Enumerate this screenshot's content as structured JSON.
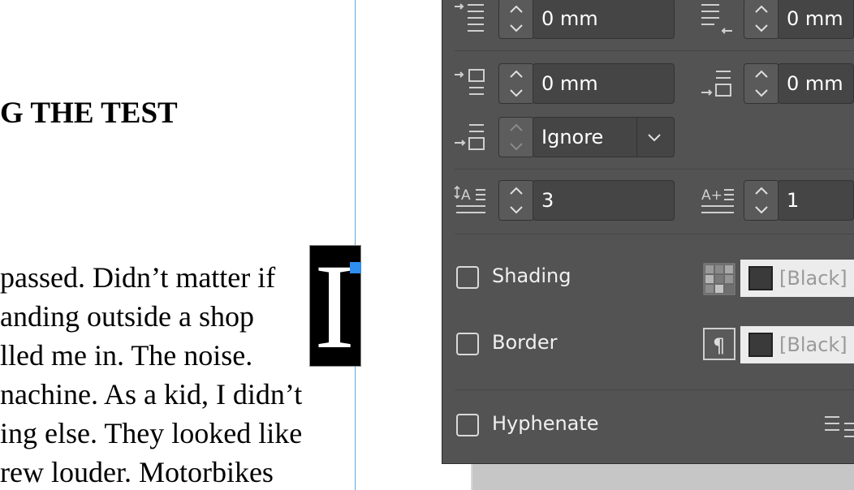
{
  "document": {
    "heading": "G THE TEST",
    "lines": [
      "passed. Didn’t matter if",
      "anding outside a shop",
      "lled me in. The noise.",
      "nachine. As a kid, I didn’t",
      "ing else. They looked like",
      "rew louder. Motorbikes"
    ],
    "drop_cap": "I"
  },
  "panel": {
    "space_before": {
      "value": "0 mm",
      "icon": "space-before-icon"
    },
    "space_after": {
      "value": "0 mm",
      "icon": "space-after-icon"
    },
    "drop_cap_before": {
      "value": "0 mm",
      "icon": "indent-top-icon"
    },
    "drop_cap_after": {
      "value": "0 mm",
      "icon": "indent-bottom-icon"
    },
    "align_mode": {
      "value": "Ignore",
      "icon": "align-ignore-icon"
    },
    "drop_cap_lines": {
      "value": "3",
      "icon": "drop-cap-lines-icon"
    },
    "drop_cap_chars": {
      "value": "1",
      "icon": "drop-cap-chars-icon"
    },
    "shading": {
      "label": "Shading",
      "checked": false,
      "swatch": "[Black]",
      "icon": "tint-grid-icon"
    },
    "border": {
      "label": "Border",
      "checked": false,
      "swatch": "[Black]",
      "icon": "paragraph-border-icon"
    },
    "hyphenate": {
      "label": "Hyphenate",
      "checked": false,
      "icon": "justify-icon"
    }
  },
  "colors": {
    "panel_bg": "#535353",
    "field_bg": "#454545",
    "guide": "#5aa6dc",
    "handle": "#2e8ff0"
  }
}
